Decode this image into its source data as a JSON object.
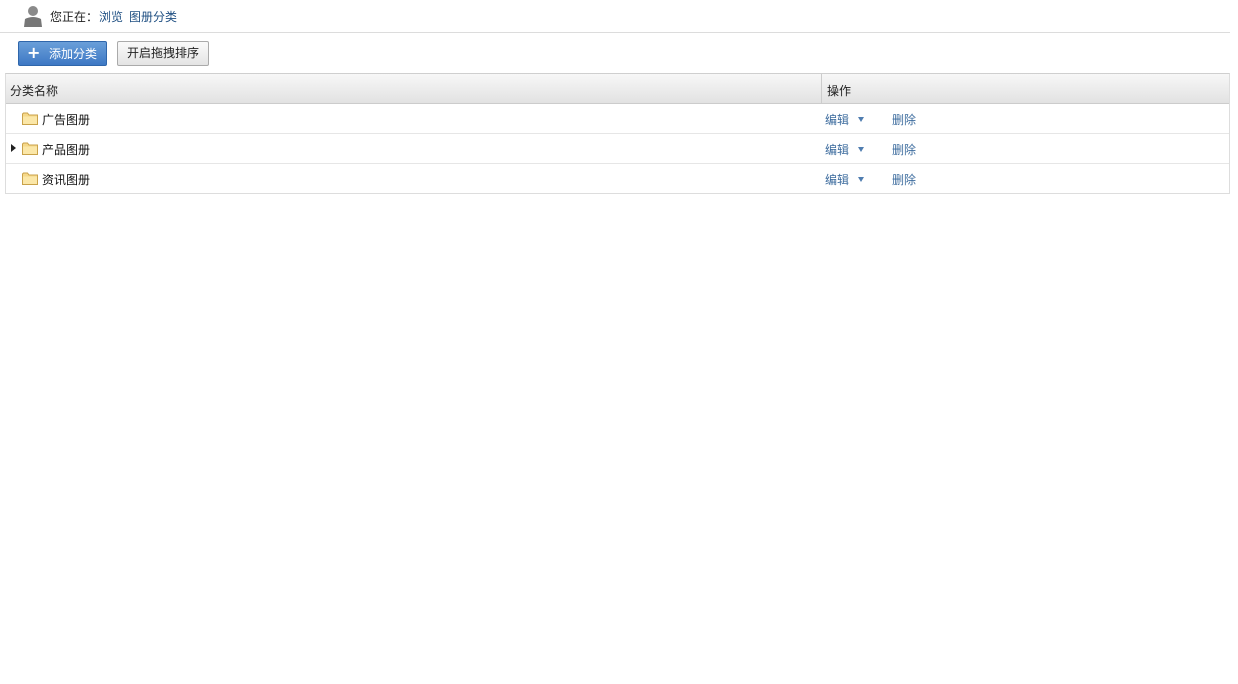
{
  "breadcrumb": {
    "prefix": "您正在：",
    "items": [
      "浏览",
      "图册分类"
    ]
  },
  "toolbar": {
    "add_label": "添加分类",
    "sort_label": "开启拖拽排序"
  },
  "table": {
    "columns": [
      "分类名称",
      "操作"
    ],
    "rows": [
      {
        "name": "广告图册",
        "expandable": false,
        "edit": "编辑",
        "delete": "删除"
      },
      {
        "name": "产品图册",
        "expandable": true,
        "edit": "编辑",
        "delete": "删除"
      },
      {
        "name": "资讯图册",
        "expandable": false,
        "edit": "编辑",
        "delete": "删除"
      }
    ]
  },
  "icons": {
    "avatar": "user-avatar-icon",
    "folder": "folder-icon",
    "expand": "expand-arrow-icon",
    "dropdown": "dropdown-caret-icon",
    "add": "plus-icon"
  },
  "colors": {
    "link": "#1f4f82",
    "action_link": "#3d6c9e",
    "primary_button": "#3d78c4"
  }
}
